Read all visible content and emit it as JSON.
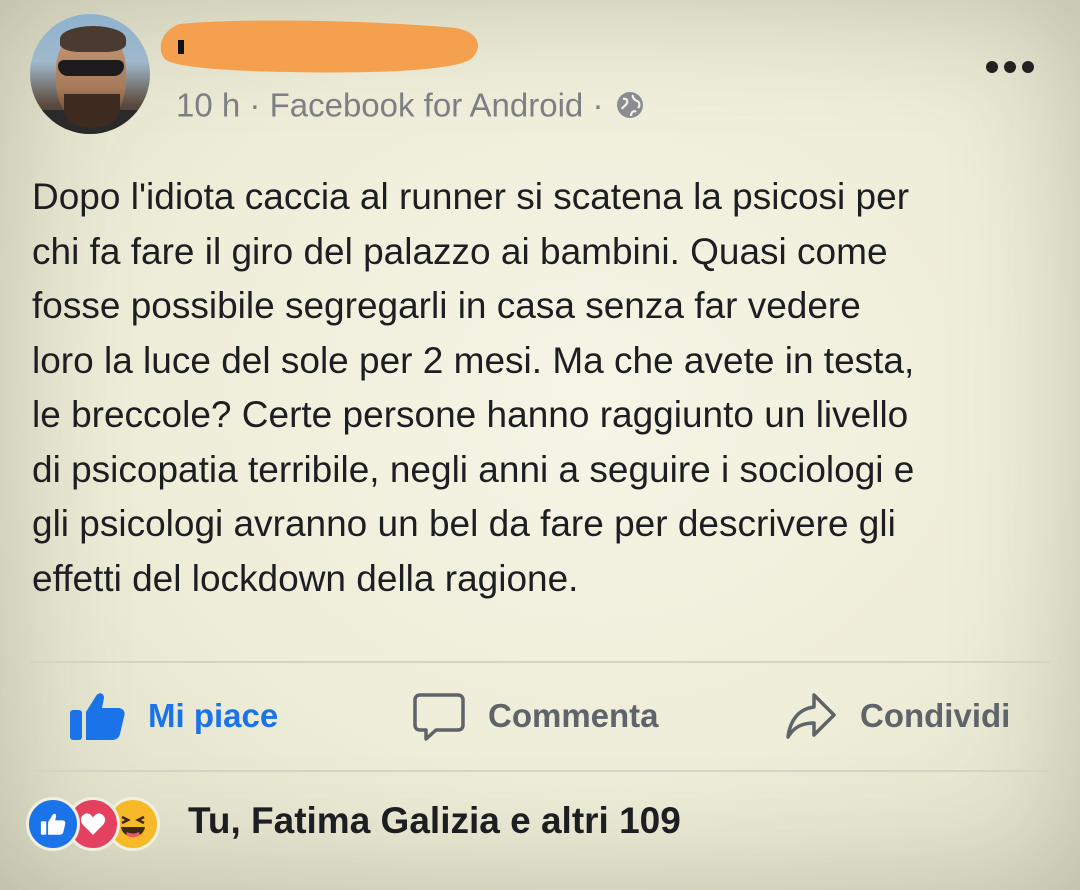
{
  "post": {
    "time": "10 h",
    "separator": "·",
    "source": "Facebook for Android",
    "text": "Dopo l'idiota caccia al runner si scatena la psicosi per\nchi fa fare il giro del palazzo ai bambini. Quasi come\nfosse possibile segregarli in casa senza far vedere\nloro la luce del sole per 2 mesi. Ma che avete in testa,\nle breccole? Certe persone hanno raggiunto un livello\ndi psicopatia terribile, negli anni a seguire i sociologi e\ngli psicologi avranno un bel da fare per descrivere gli\neffetti del lockdown della ragione."
  },
  "actions": {
    "like_label": "Mi piace",
    "comment_label": "Commenta",
    "share_label": "Condividi"
  },
  "reactions": {
    "icons": [
      "like-icon",
      "love-icon",
      "haha-icon"
    ],
    "summary": "Tu, Fatima Galizia e altri 109"
  },
  "colors": {
    "accent_blue": "#1a73e8",
    "love_red": "#e4405f",
    "haha_yellow": "#f7b928",
    "redaction_orange": "#f5a04f",
    "meta_gray": "#7d7f84"
  },
  "icons": {
    "header": [
      "avatar",
      "globe-icon",
      "more-options-icon"
    ],
    "actions": [
      "thumbs-up-icon",
      "comment-icon",
      "share-icon"
    ]
  }
}
